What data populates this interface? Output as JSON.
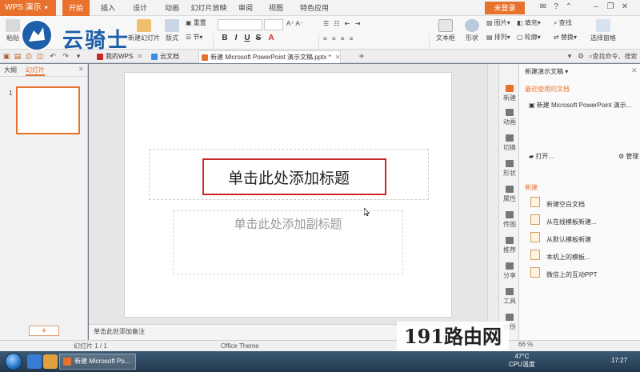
{
  "app": {
    "name": "WPS 演示",
    "ribbon_tabs": [
      "开始",
      "插入",
      "设计",
      "动画",
      "幻灯片放映",
      "审阅",
      "视图",
      "特色应用"
    ],
    "active_tab": "开始",
    "login_label": "未登录"
  },
  "ribbon": {
    "paste": "粘贴",
    "new_slide": "新建幻灯片",
    "layout": "版式",
    "reset": "重置",
    "section": "节",
    "font_name": "",
    "font_size": "",
    "textbox": "文本框",
    "shape": "形状",
    "picture": "图片",
    "arrange": "排列",
    "fill": "填充",
    "outline": "轮廓",
    "find": "查找",
    "replace": "替换",
    "select_pane": "选择窗格",
    "format_buttons": [
      "B",
      "I",
      "U",
      "S",
      "A"
    ]
  },
  "watermark_logo": "云骑士",
  "doc_tabs": [
    {
      "label": "我的WPS",
      "color": "#c8282c"
    },
    {
      "label": "云文档",
      "color": "#3a8ee6"
    },
    {
      "label": "新建 Microsoft PowerPoint 演示文稿.pptx *",
      "color": "#e8722c"
    }
  ],
  "search_placeholder": "查找命令、搜索",
  "left_panel": {
    "tabs": [
      "大纲",
      "幻灯片"
    ],
    "active_tab": "幻灯片",
    "slide_number": "1",
    "add_label": "+"
  },
  "slide": {
    "title_placeholder": "单击此处添加标题",
    "subtitle_placeholder": "单击此处添加副标题"
  },
  "notes_placeholder": "单击此处添加备注",
  "vertical_bar": [
    "新建",
    "动画",
    "切换",
    "形状",
    "属性",
    "传图",
    "推荐",
    "分享",
    "工具",
    "备份"
  ],
  "task_pane": {
    "header": "新建演示文稿",
    "recent_section": "最近使用的文档",
    "recent_items": [
      "新建 Microsoft PowerPoint 演示..."
    ],
    "open_label": "打开...",
    "manage_label": "管理",
    "new_section": "新建",
    "new_items": [
      "新建空白文档",
      "从在线模板新建...",
      "从默认模板新建",
      "本机上的模板...",
      "微信上的互动PPT"
    ]
  },
  "status": {
    "slide_info": "幻灯片 1 / 1",
    "theme": "Office Theme",
    "zoom": "66 %"
  },
  "taskbar": {
    "window_title": "新建 Microsoft Po...",
    "temp": "47°C",
    "temp_label": "CPU温度",
    "clock": "17:27"
  },
  "watermark_site": "191路由网"
}
